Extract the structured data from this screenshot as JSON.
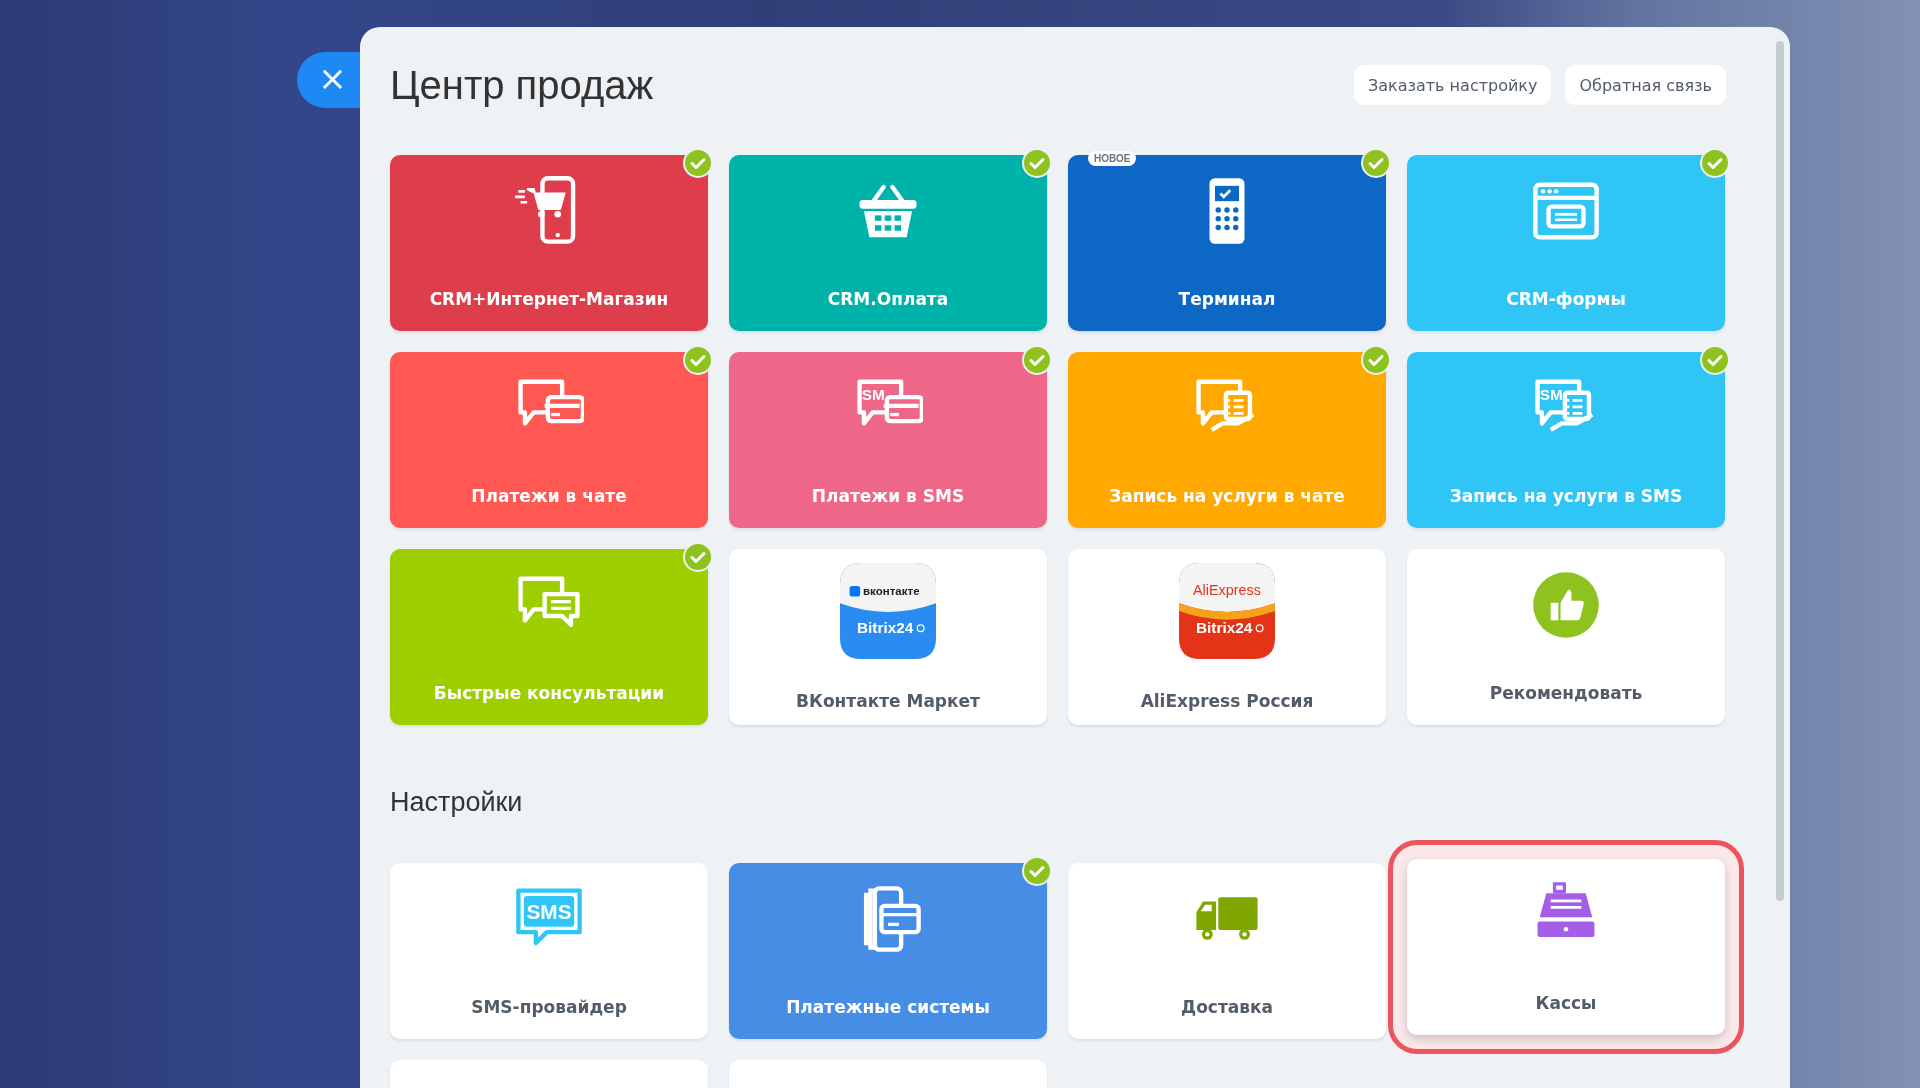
{
  "close_button": {
    "label": "×"
  },
  "header": {
    "title": "Центр продаж",
    "buttons": [
      "Заказать настройку",
      "Обратная связь"
    ]
  },
  "apps": [
    {
      "kind": "colored",
      "label": "CRM+Интернет-Магазин",
      "color": "#de3e4b",
      "checked": true
    },
    {
      "kind": "colored",
      "label": "CRM.Оплата",
      "color": "#00b3aa",
      "checked": true
    },
    {
      "kind": "colored",
      "label": "Терминал",
      "color": "#0c67c5",
      "checked": true,
      "badge": "НОВОЕ"
    },
    {
      "kind": "colored",
      "label": "CRM-формы",
      "color": "#2fc6f6",
      "checked": true
    },
    {
      "kind": "colored",
      "label": "Платежи в чате",
      "color": "#ff5752",
      "checked": true
    },
    {
      "kind": "colored",
      "label": "Платежи в SMS",
      "color": "#ee6789",
      "checked": true,
      "icon_text": "SM"
    },
    {
      "kind": "colored",
      "label": "Запись на услуги в чате",
      "color": "#ffa900",
      "checked": true
    },
    {
      "kind": "colored",
      "label": "Запись на услуги в SMS",
      "color": "#2fc6f6",
      "checked": true,
      "icon_text": "SM"
    },
    {
      "kind": "colored",
      "label": "Быстрые консультации",
      "color": "#9dcf00",
      "checked": true
    },
    {
      "kind": "logo",
      "label": "ВКонтакте Маркет",
      "checked": false,
      "logo_texts": [
        "вконтакте",
        "Bitrix24"
      ]
    },
    {
      "kind": "logo",
      "label": "AliExpress Россия",
      "checked": false,
      "logo_texts": [
        "AliExpress",
        "Bitrix24"
      ]
    },
    {
      "kind": "white",
      "label": "Рекомендовать",
      "checked": false
    }
  ],
  "settings": {
    "title": "Настройки",
    "tiles": [
      {
        "kind": "white",
        "label": "SMS-провайдер",
        "checked": false,
        "highlighted": false,
        "icon_text": "SMS"
      },
      {
        "kind": "colored",
        "label": "Платежные системы",
        "color": "#468ee5",
        "checked": true,
        "highlighted": false
      },
      {
        "kind": "white",
        "label": "Доставка",
        "checked": false,
        "highlighted": false
      },
      {
        "kind": "white",
        "label": "Кассы",
        "checked": false,
        "highlighted": true
      },
      {
        "kind": "blank",
        "highlighted": false
      },
      {
        "kind": "blank",
        "highlighted": false
      }
    ]
  }
}
